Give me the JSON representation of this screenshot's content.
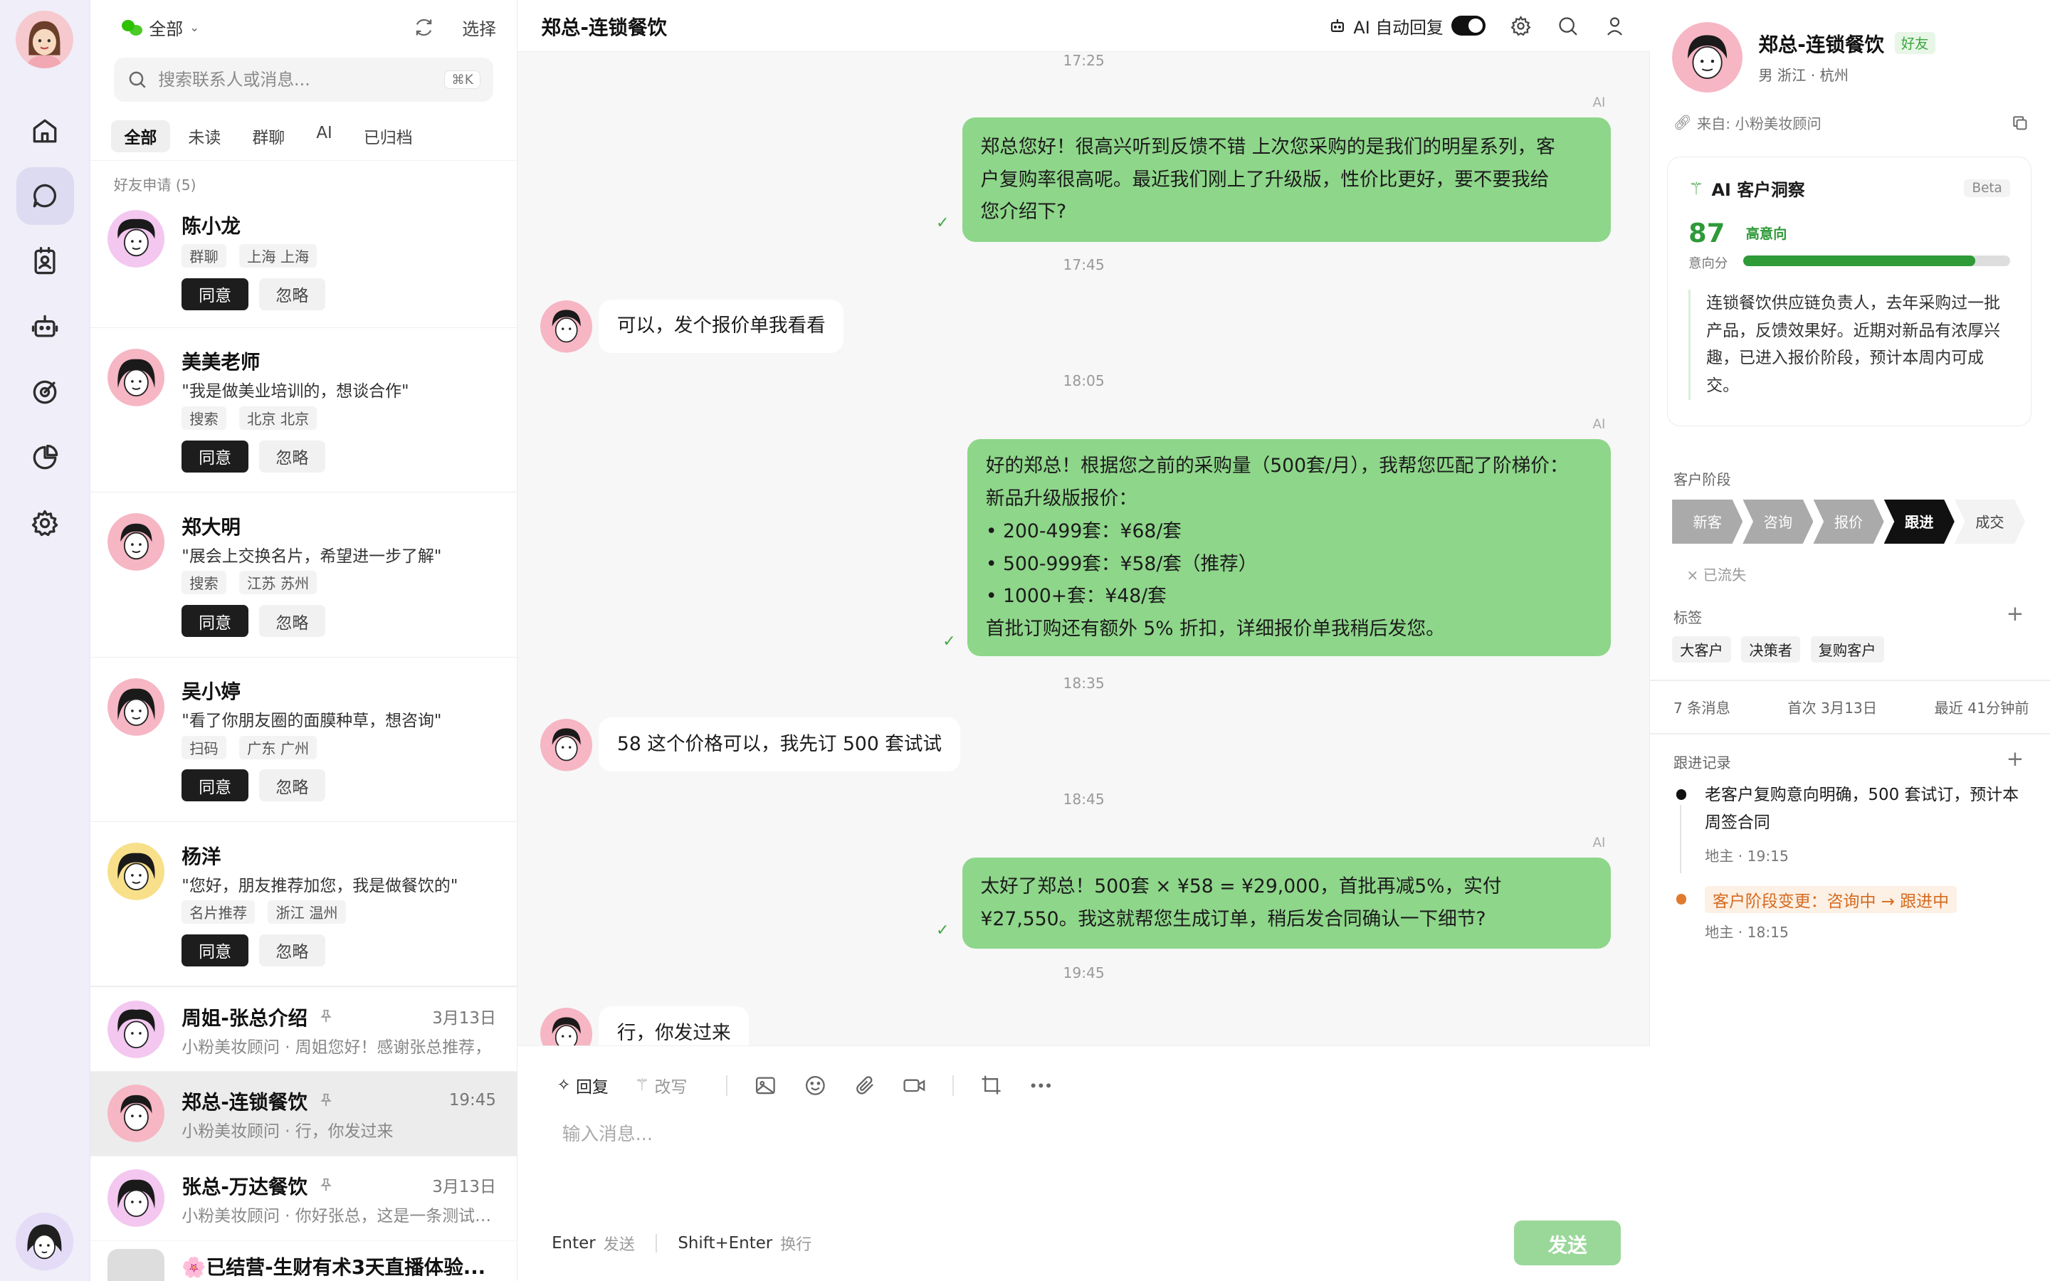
{
  "colors": {
    "accent_green": "#2e9a38",
    "bubble_green": "#8ed68a",
    "send_button": "#9ad89a",
    "rail_bg": "#efeef9",
    "orange": "#d46a1f"
  },
  "rail": {
    "items": [
      {
        "icon": "home-icon"
      },
      {
        "icon": "chat-icon",
        "active": true
      },
      {
        "icon": "contacts-icon"
      },
      {
        "icon": "bot-icon"
      },
      {
        "icon": "target-icon"
      },
      {
        "icon": "pie-chart-icon"
      },
      {
        "icon": "settings-icon"
      }
    ]
  },
  "contacts": {
    "filter_label": "全部",
    "select_label": "选择",
    "search_placeholder": "搜索联系人或消息...",
    "search_shortcut": "⌘K",
    "tabs": [
      "全部",
      "未读",
      "群聊",
      "AI",
      "已归档"
    ],
    "section_title": "好友申请 (5)",
    "requests": [
      {
        "name": "陈小龙",
        "message": "",
        "tags": [
          "群聊",
          "上海 上海"
        ],
        "agree": "同意",
        "ignore": "忽略"
      },
      {
        "name": "美美老师",
        "message": "\"我是做美业培训的，想谈合作\"",
        "tags": [
          "搜索",
          "北京 北京"
        ],
        "agree": "同意",
        "ignore": "忽略"
      },
      {
        "name": "郑大明",
        "message": "\"展会上交换名片，希望进一步了解\"",
        "tags": [
          "搜索",
          "江苏 苏州"
        ],
        "agree": "同意",
        "ignore": "忽略"
      },
      {
        "name": "吴小婷",
        "message": "\"看了你朋友圈的面膜种草，想咨询\"",
        "tags": [
          "扫码",
          "广东 广州"
        ],
        "agree": "同意",
        "ignore": "忽略"
      },
      {
        "name": "杨洋",
        "message": "\"您好，朋友推荐加您，我是做餐饮的\"",
        "tags": [
          "名片推荐",
          "浙江 温州"
        ],
        "agree": "同意",
        "ignore": "忽略"
      }
    ],
    "conversations": [
      {
        "name": "周姐-张总介绍",
        "time": "3月13日",
        "preview": "小粉美妆顾问 · 周姐您好！感谢张总推荐，",
        "active": false
      },
      {
        "name": "郑总-连锁餐饮",
        "time": "19:45",
        "preview": "小粉美妆顾问 · 行，你发过来",
        "active": true
      },
      {
        "name": "张总-万达餐饮",
        "time": "3月13日",
        "preview": "小粉美妆顾问 · 你好张总，这是一条测试消息",
        "active": false
      },
      {
        "name": "🌸已结营-生财有术3天直播体验...",
        "time": "",
        "preview": "",
        "active": false
      }
    ]
  },
  "chat": {
    "title": "郑总-连锁餐饮",
    "ai_auto_reply_label": "AI 自动回复",
    "ai_auto_reply_on": true,
    "ai_label": "AI",
    "timestamps": [
      "17:25",
      "17:45",
      "18:05",
      "18:35",
      "18:45",
      "19:45"
    ],
    "messages": [
      {
        "dir": "out",
        "lines": [
          "郑总您好！很高兴听到反馈不错 上次您采购的是我们的明星系列，客",
          "户复购率很高呢。最近我们刚上了升级版，性价比更好，要不要我给",
          "您介绍下?"
        ]
      },
      {
        "dir": "in",
        "lines": [
          "可以，发个报价单我看看"
        ]
      },
      {
        "dir": "out",
        "lines": [
          "好的郑总！根据您之前的采购量（500套/月），我帮您匹配了阶梯价：",
          "新品升级版报价：",
          "• 200-499套：¥68/套",
          "• 500-999套：¥58/套（推荐）",
          "• 1000+套：¥48/套",
          "首批订购还有额外 5% 折扣，详细报价单我稍后发您。"
        ]
      },
      {
        "dir": "in",
        "lines": [
          "58 这个价格可以，我先订 500 套试试"
        ]
      },
      {
        "dir": "out",
        "lines": [
          "太好了郑总！500套 × ¥58 = ¥29,000，首批再减5%，实付",
          "¥27,550。我这就帮您生成订单，稍后发合同确认一下细节?"
        ]
      },
      {
        "dir": "in",
        "lines": [
          "行，你发过来"
        ]
      }
    ],
    "composer": {
      "reply_label": "回复",
      "rewrite_label": "改写",
      "placeholder": "输入消息...",
      "enter_key": "Enter",
      "enter_desc": "发送",
      "shift_key": "Shift+Enter",
      "shift_desc": "换行",
      "send_label": "发送"
    }
  },
  "profile": {
    "name": "郑总-连锁餐饮",
    "badge": "好友",
    "sub": "男  浙江 · 杭州",
    "source": "来自: 小粉美妆顾问",
    "insight": {
      "title": "AI 客户洞察",
      "beta": "Beta",
      "score": "87",
      "score_value": 87,
      "level": "高意向",
      "score_label": "意向分",
      "summary": "连锁餐饮供应链负责人，去年采购过一批产品，反馈效果好。近期对新品有浓厚兴趣，已进入报价阶段，预计本周内可成交。"
    },
    "stage_label": "客户阶段",
    "stages": [
      "新客",
      "咨询",
      "报价",
      "跟进",
      "成交"
    ],
    "current_stage": "跟进",
    "lost_label": "× 已流失",
    "tags_label": "标签",
    "tags": [
      "大客户",
      "决策者",
      "复购客户"
    ],
    "stats": {
      "messages": "7 条消息",
      "first": "首次 3月13日",
      "last": "最近 41分钟前"
    },
    "records_label": "跟进记录",
    "records": [
      {
        "text": "老客户复购意向明确，500 套试订，预计本周签合同",
        "meta": "地主 · 19:15"
      },
      {
        "text": "客户阶段变更：咨询中 → 跟进中",
        "meta": "地主 · 18:15"
      }
    ]
  }
}
